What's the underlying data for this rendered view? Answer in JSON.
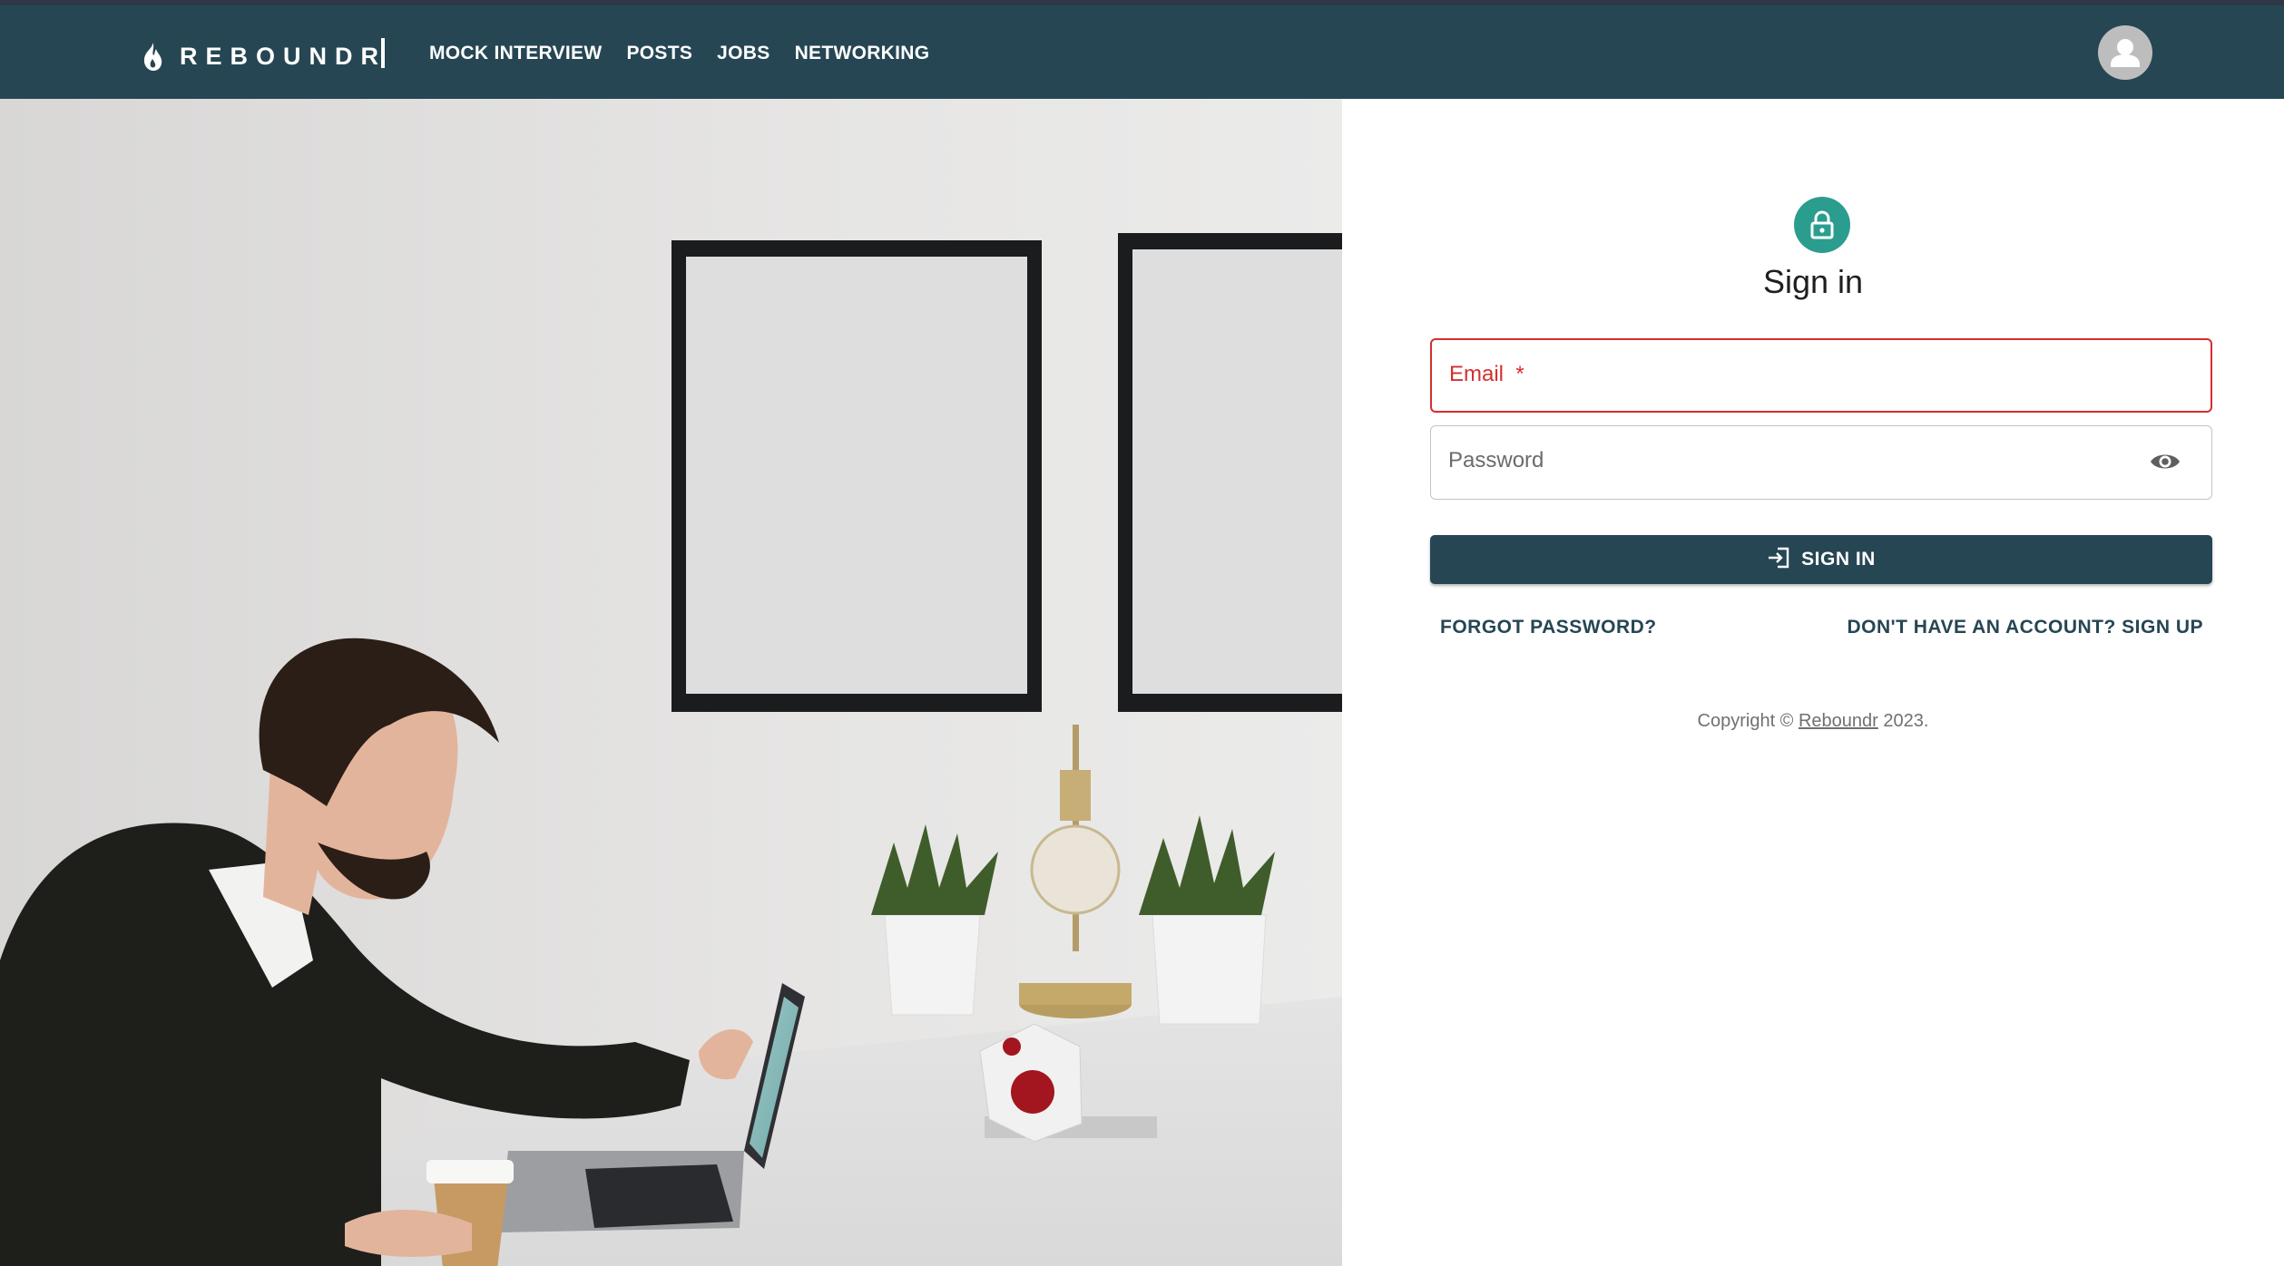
{
  "brand": {
    "name": "REBOUNDR",
    "icon": "flame-icon"
  },
  "nav": {
    "links": [
      "MOCK INTERVIEW",
      "POSTS",
      "JOBS",
      "NETWORKING"
    ],
    "avatar_icon": "user-avatar-icon"
  },
  "hero": {
    "image_icon": "person-working-at-laptop-photo"
  },
  "signin": {
    "title": "Sign in",
    "lock_icon": "lock-icon",
    "email": {
      "label": "Email",
      "required_mark": "*",
      "value": ""
    },
    "password": {
      "label": "Password",
      "value": "",
      "toggle_icon": "eye-icon"
    },
    "submit_label": "SIGN IN",
    "submit_icon": "login-icon",
    "forgot_label": "FORGOT PASSWORD?",
    "signup_label": "DON'T HAVE AN ACCOUNT? SIGN UP",
    "copyright_prefix": "Copyright ©",
    "copyright_link": "Reboundr",
    "copyright_year": "2023."
  },
  "colors": {
    "navbar": "#264653",
    "accent": "#2a9d8f",
    "error": "#d32f2f",
    "button": "#264653"
  }
}
